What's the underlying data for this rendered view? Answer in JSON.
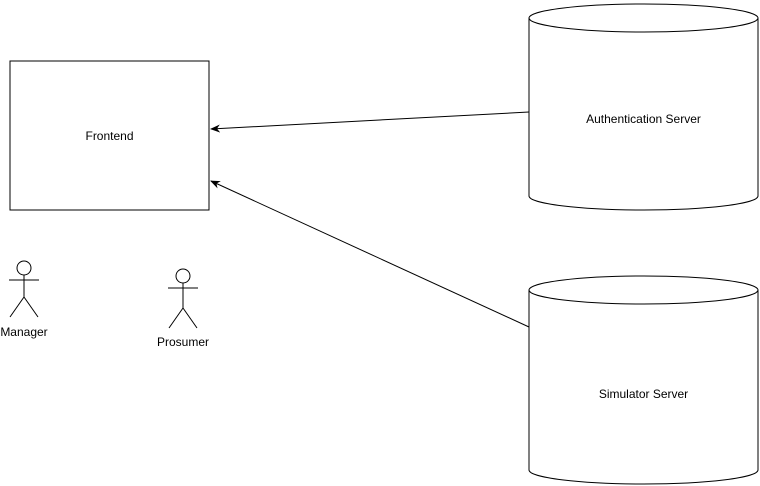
{
  "diagram": {
    "nodes": {
      "frontend": {
        "label": "Frontend",
        "shape": "rectangle"
      },
      "auth_server": {
        "label": "Authentication Server",
        "shape": "cylinder"
      },
      "sim_server": {
        "label": "Simulator Server",
        "shape": "cylinder"
      },
      "manager": {
        "label": "Manager",
        "shape": "actor"
      },
      "prosumer": {
        "label": "Prosumer",
        "shape": "actor"
      }
    },
    "edges": [
      {
        "from": "Authentication Server",
        "to": "Frontend",
        "arrow": "end"
      },
      {
        "from": "Simulator Server",
        "to": "Frontend",
        "arrow": "end"
      }
    ],
    "colors": {
      "stroke": "#000000",
      "fill": "#ffffff"
    }
  }
}
